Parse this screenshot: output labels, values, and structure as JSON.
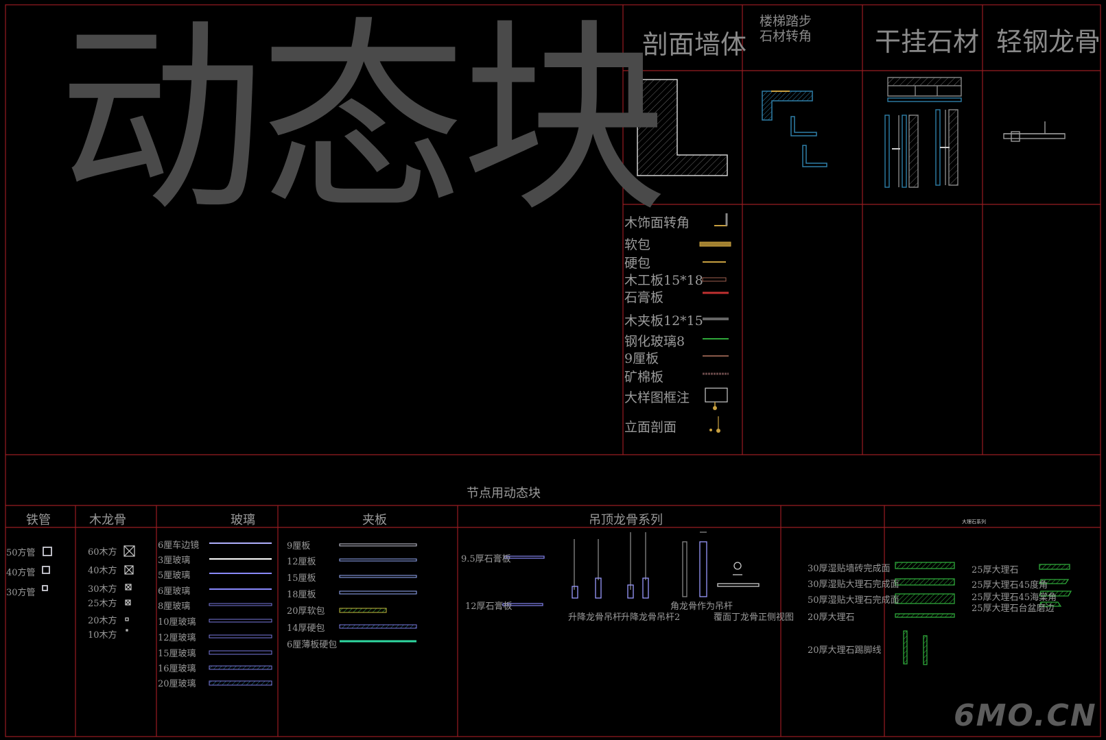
{
  "title": "动态块",
  "headers": {
    "section_wall": "剖面墙体",
    "stair_line1": "楼梯踏步",
    "stair_line2": "石材转角",
    "dry_stone": "干挂石材",
    "light_steel": "轻钢龙骨"
  },
  "legend": [
    "木饰面转角",
    "软包",
    "硬包",
    "木工板15*18",
    "石膏板",
    "木夹板12*15",
    "钢化玻璃8",
    "9厘板",
    "矿棉板",
    "大样图框注",
    "立面剖面"
  ],
  "nodes_title": "节点用动态块",
  "columns": {
    "iron": "铁管",
    "wood": "木龙骨",
    "glass": "玻璃",
    "board": "夹板",
    "ceiling": "吊顶龙骨系列",
    "marble": "大理石系列"
  },
  "iron_items": [
    "50方管",
    "40方管",
    "30方管"
  ],
  "wood_items": [
    "60木方",
    "40木方",
    "30木方",
    "25木方",
    "20木方",
    "10木方"
  ],
  "glass_items": [
    "6厘车边镜",
    "3厘玻璃",
    "5厘玻璃",
    "6厘玻璃",
    "8厘玻璃",
    "10厘玻璃",
    "12厘玻璃",
    "15厘玻璃",
    "16厘玻璃",
    "20厘玻璃"
  ],
  "board_items": [
    "9厘板",
    "12厘板",
    "15厘板",
    "18厘板",
    "20厚软包",
    "14厚硬包",
    "6厘薄板硬包"
  ],
  "ceiling_items": [
    "9.5厚石膏板",
    "12厚石膏板"
  ],
  "ceiling_captions": [
    "升降龙骨吊杆",
    "升降龙骨吊杆2",
    "角龙骨作为吊杆",
    "覆面丁龙骨正侧视图"
  ],
  "marble_left": [
    "30厚湿贴墙砖完成面",
    "30厚湿贴大理石完成面",
    "50厚湿贴大理石完成面",
    "20厚大理石",
    "20厚大理石踢脚线"
  ],
  "marble_right": [
    "25厚大理石",
    "25厚大理石45度角",
    "25厚大理石45海棠角",
    "25厚大理石台盆磨边"
  ],
  "watermark": "6MO.CN",
  "colors": {
    "frame": "#9a1c22",
    "cyan": "#2f7fa8",
    "blue": "#5a62d8",
    "green": "#2fa83a",
    "hatch": "#777777"
  }
}
